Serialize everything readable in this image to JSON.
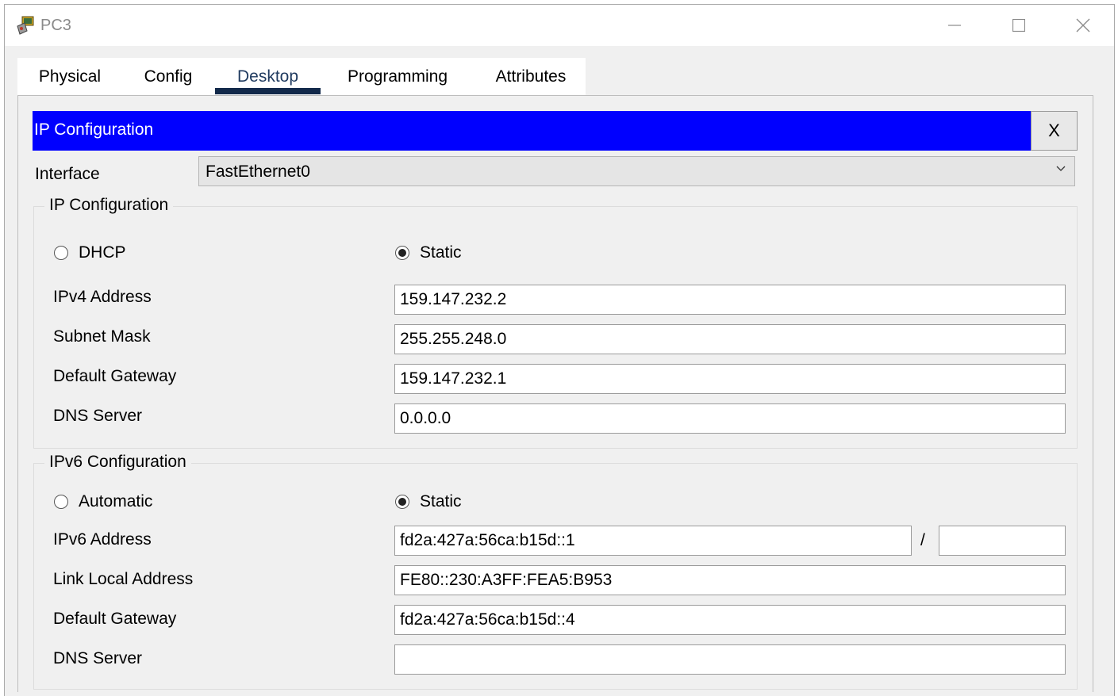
{
  "window": {
    "title": "PC3",
    "icon": "packet-tracer-pc-icon"
  },
  "tabs": [
    {
      "label": "Physical"
    },
    {
      "label": "Config"
    },
    {
      "label": "Desktop",
      "active": true
    },
    {
      "label": "Programming"
    },
    {
      "label": "Attributes"
    }
  ],
  "panel": {
    "title": "IP Configuration",
    "close_label": "X",
    "accent_color": "#0000ff"
  },
  "interface": {
    "label": "Interface",
    "value": "FastEthernet0"
  },
  "ipv4": {
    "legend": "IP Configuration",
    "dhcp_label": "DHCP",
    "static_label": "Static",
    "mode": "Static",
    "address_label": "IPv4 Address",
    "address": "159.147.232.2",
    "mask_label": "Subnet Mask",
    "mask": "255.255.248.0",
    "gateway_label": "Default Gateway",
    "gateway": "159.147.232.1",
    "dns_label": "DNS Server",
    "dns": "0.0.0.0"
  },
  "ipv6": {
    "legend": "IPv6 Configuration",
    "auto_label": "Automatic",
    "static_label": "Static",
    "mode": "Static",
    "address_label": "IPv6 Address",
    "address": "fd2a:427a:56ca:b15d::1",
    "prefix_sep": "/",
    "prefix": "",
    "link_local_label": "Link Local Address",
    "link_local": "FE80::230:A3FF:FEA5:B953",
    "gateway_label": "Default Gateway",
    "gateway": "fd2a:427a:56ca:b15d::4",
    "dns_label": "DNS Server",
    "dns": ""
  }
}
